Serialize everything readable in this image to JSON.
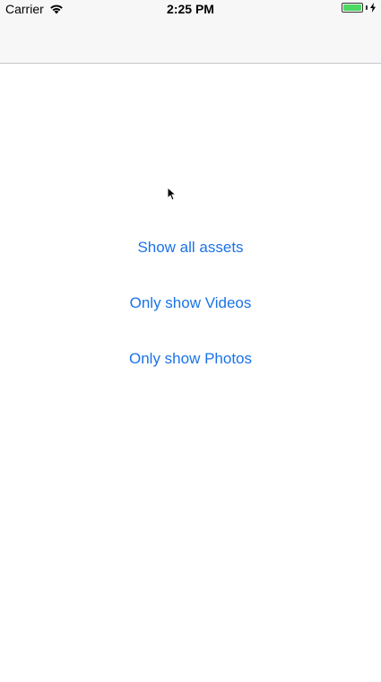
{
  "status_bar": {
    "carrier": "Carrier",
    "time": "2:25 PM",
    "battery_level": 1.0,
    "battery_color": "#4cd964",
    "icons": [
      "wifi-icon",
      "battery-icon",
      "charging-bolt-icon"
    ]
  },
  "buttons": {
    "show_all": "Show all assets",
    "only_videos": "Only show Videos",
    "only_photos": "Only show Photos"
  },
  "colors": {
    "accent": "#1a73e8",
    "bar_background": "#f7f7f7",
    "separator": "#c8c7cc"
  }
}
